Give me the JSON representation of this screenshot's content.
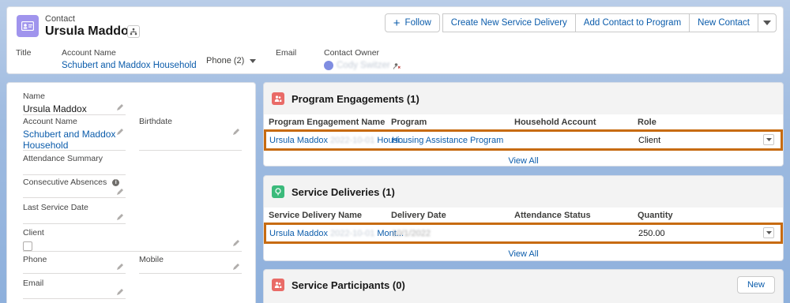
{
  "header": {
    "type_label": "Contact",
    "name": "Ursula Maddox",
    "actions": {
      "follow": "Follow",
      "create_service_delivery": "Create New Service Delivery",
      "add_to_program": "Add Contact to Program",
      "new_contact": "New Contact"
    },
    "fields": {
      "title_label": "Title",
      "account_label": "Account Name",
      "account_value": "Schubert and Maddox Household",
      "phone_label": "Phone (2)",
      "email_label": "Email",
      "owner_label": "Contact Owner",
      "owner_value": "Cody Switzer"
    }
  },
  "details": {
    "name_label": "Name",
    "name_value": "Ursula Maddox",
    "account_label": "Account Name",
    "account_value_line1": "Schubert and Maddox",
    "account_value_line2": "Household",
    "birthdate_label": "Birthdate",
    "attendance_label": "Attendance Summary",
    "absences_label": "Consecutive Absences",
    "last_service_label": "Last Service Date",
    "client_label": "Client",
    "phone_label": "Phone",
    "mobile_label": "Mobile",
    "email_label": "Email"
  },
  "program_engagements": {
    "title": "Program Engagements (1)",
    "columns": [
      "Program Engagement Name",
      "Program",
      "Household Account",
      "Role"
    ],
    "row": {
      "name_prefix": "Ursula Maddox",
      "name_blurred": "2022-10-01",
      "name_suffix": "Housi...",
      "program": "Housing Assistance Program",
      "household": "",
      "role": "Client"
    },
    "view_all": "View All"
  },
  "service_deliveries": {
    "title": "Service Deliveries (1)",
    "columns": [
      "Service Delivery Name",
      "Delivery Date",
      "Attendance Status",
      "Quantity"
    ],
    "row": {
      "name_prefix": "Ursula Maddox",
      "name_blurred": "2022-10-01",
      "name_suffix": "Mont...",
      "date_blurred": "10/1/2022",
      "attendance": "",
      "quantity": "250.00"
    },
    "view_all": "View All"
  },
  "service_participants": {
    "title": "Service Participants (0)",
    "new_label": "New"
  },
  "colors": {
    "contact_icon": "#a094ed",
    "related_icon": "#e96b67",
    "delivery_icon": "#3bba7b",
    "highlight": "#c76b11",
    "link": "#0b5cab"
  }
}
